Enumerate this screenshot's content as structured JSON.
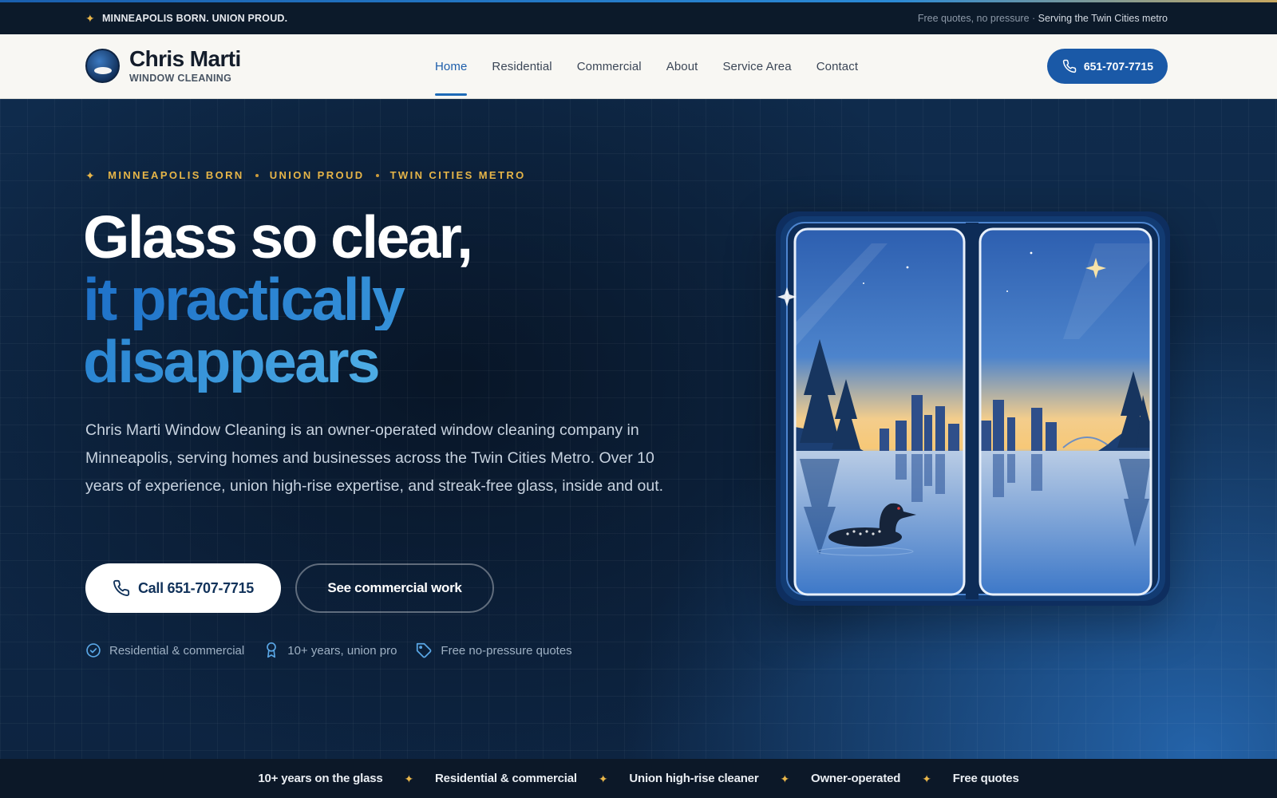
{
  "topbar": {
    "tagline": "MINNEAPOLIS BORN. UNION PROUD.",
    "right_muted": "Free quotes, no pressure ·",
    "right_strong": "Serving the Twin Cities metro"
  },
  "brand": {
    "name": "Chris Marti",
    "subtitle": "WINDOW CLEANING"
  },
  "nav": {
    "items": [
      {
        "label": "Home",
        "active": true
      },
      {
        "label": "Residential"
      },
      {
        "label": "Commercial"
      },
      {
        "label": "About"
      },
      {
        "label": "Service Area"
      },
      {
        "label": "Contact"
      }
    ],
    "phone_label": "651-707-7715"
  },
  "hero": {
    "eyebrow": [
      "MINNEAPOLIS BORN",
      "UNION PROUD",
      "TWIN CITIES METRO"
    ],
    "headline": [
      "Glass so clear,",
      "it practically",
      "disappears"
    ],
    "description": "Chris Marti Window Cleaning is an owner-operated window cleaning company in Minneapolis, serving homes and businesses across the Twin Cities Metro. Over 10 years of experience, union high-rise expertise, and streak-free glass, inside and out.",
    "cta_primary": "Call 651-707-7715",
    "cta_secondary": "See commercial work",
    "features": [
      {
        "label": "Residential & commercial",
        "icon": "check-circle-icon"
      },
      {
        "label": "10+ years, union pro",
        "icon": "award-ribbon-icon"
      },
      {
        "label": "Free no-pressure quotes",
        "icon": "tag-icon"
      }
    ]
  },
  "strip": {
    "items": [
      "10+ years on the glass",
      "Residential & commercial",
      "Union high-rise cleaner",
      "Owner-operated",
      "Free quotes"
    ]
  },
  "colors": {
    "brand_blue": "#1a59a7",
    "accent_gold": "#e6b548",
    "dark_navy": "#0c1a2a"
  }
}
